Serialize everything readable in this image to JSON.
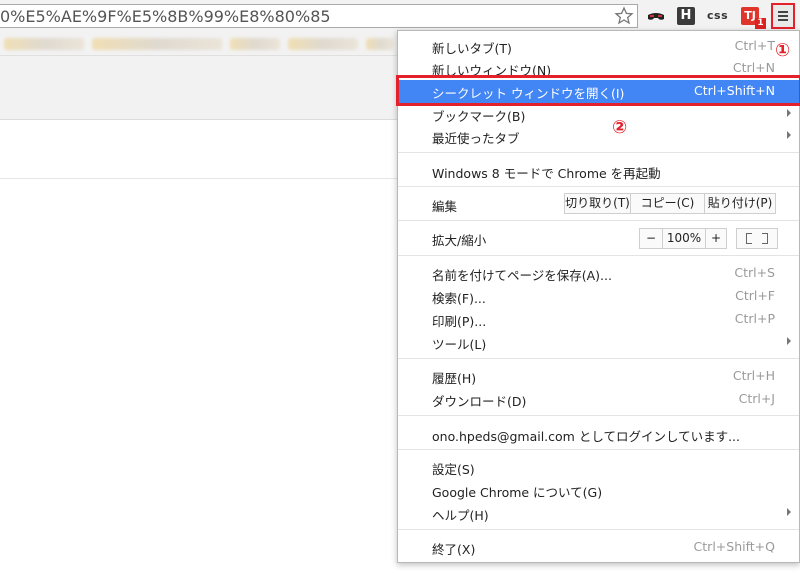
{
  "toolbar": {
    "url": "0%E5%AE%9F%E5%8B%99%E8%80%85",
    "ext_h_label": "H",
    "ext_css_label": "css",
    "ext_tj_label": "TJ",
    "ext_badge": "1"
  },
  "menu": {
    "items": [
      {
        "label": "新しいタブ(T)",
        "shortcut": "Ctrl+T"
      },
      {
        "label": "新しいウィンドウ(N)",
        "shortcut": "Ctrl+N"
      },
      {
        "label": "シークレット ウィンドウを開く(I)",
        "shortcut": "Ctrl+Shift+N"
      },
      {
        "label": "ブックマーク(B)",
        "shortcut": ""
      },
      {
        "label": "最近使ったタブ",
        "shortcut": ""
      },
      {
        "label": "Windows 8 モードで Chrome を再起動",
        "shortcut": ""
      },
      {
        "label": "編集",
        "shortcut": ""
      },
      {
        "label": "拡大/縮小",
        "shortcut": ""
      },
      {
        "label": "名前を付けてページを保存(A)...",
        "shortcut": "Ctrl+S"
      },
      {
        "label": "検索(F)...",
        "shortcut": "Ctrl+F"
      },
      {
        "label": "印刷(P)...",
        "shortcut": "Ctrl+P"
      },
      {
        "label": "ツール(L)",
        "shortcut": ""
      },
      {
        "label": "履歴(H)",
        "shortcut": "Ctrl+H"
      },
      {
        "label": "ダウンロード(D)",
        "shortcut": "Ctrl+J"
      },
      {
        "label": "ono.hpeds@gmail.com としてログインしています...",
        "shortcut": ""
      },
      {
        "label": "設定(S)",
        "shortcut": ""
      },
      {
        "label": "Google Chrome について(G)",
        "shortcut": ""
      },
      {
        "label": "ヘルプ(H)",
        "shortcut": ""
      },
      {
        "label": "終了(X)",
        "shortcut": "Ctrl+Shift+Q"
      }
    ],
    "edit": {
      "cut": "切り取り(T)",
      "copy": "コピー(C)",
      "paste": "貼り付け(P)"
    },
    "zoom": {
      "minus": "−",
      "value": "100%",
      "plus": "+"
    }
  },
  "annotations": {
    "one": "①",
    "two": "②"
  },
  "colors": {
    "highlight": "#4285f4",
    "annotation": "#e4202b"
  }
}
